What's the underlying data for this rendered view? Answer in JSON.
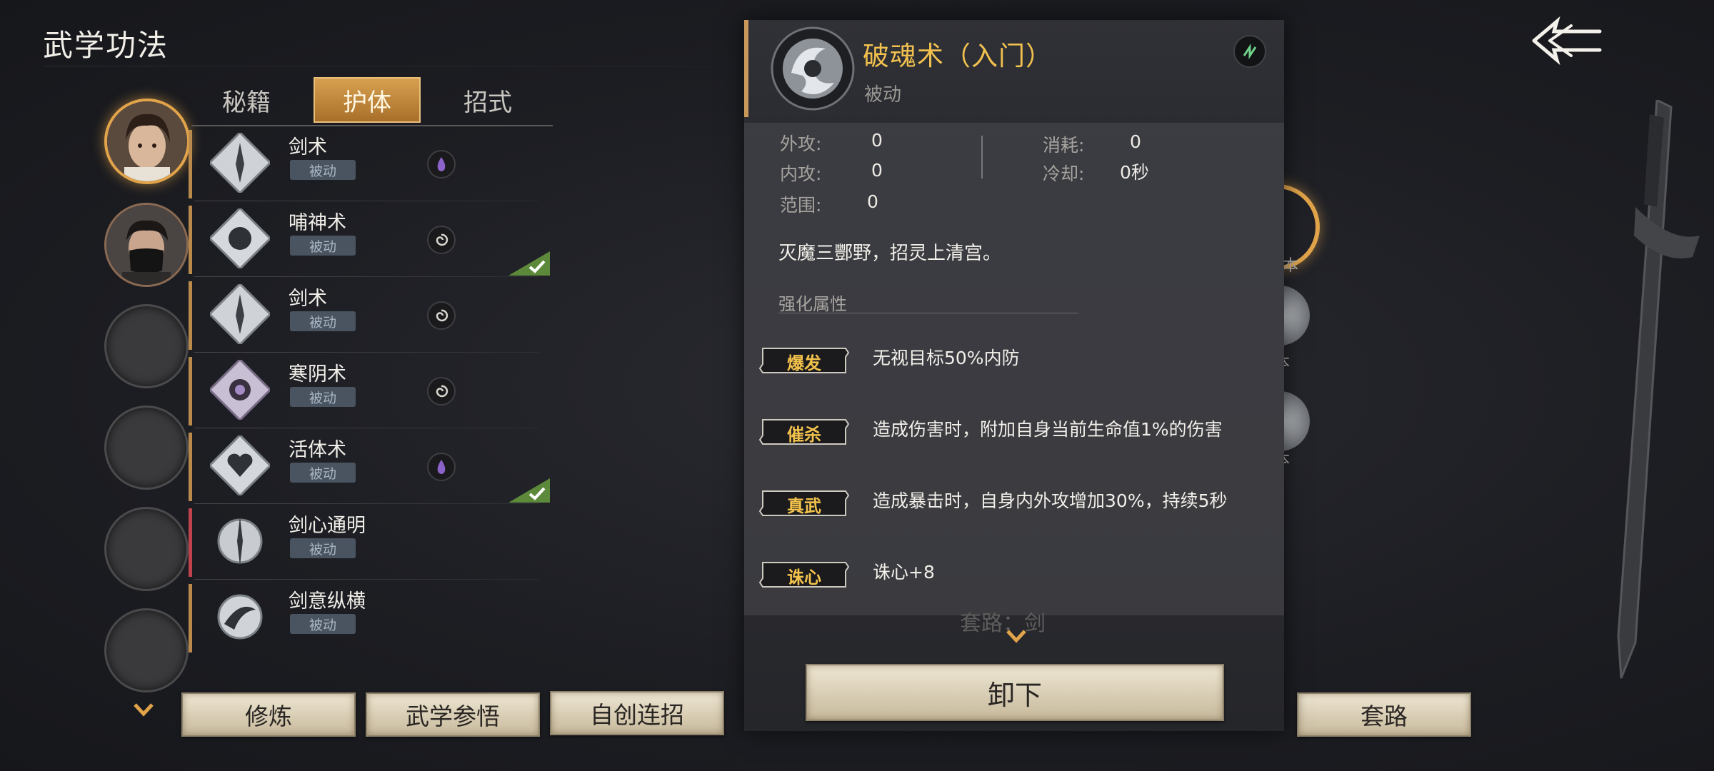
{
  "header": {
    "title": "武学功法"
  },
  "tabs": [
    {
      "label": "秘籍",
      "active": false
    },
    {
      "label": "护体",
      "active": true
    },
    {
      "label": "招式",
      "active": false
    }
  ],
  "skills": [
    {
      "name": "剑术",
      "tag": "被动",
      "slot_icon": "purple-drop-icon",
      "equipped": false,
      "bar": "gold"
    },
    {
      "name": "哺神术",
      "tag": "被动",
      "slot_icon": "swirl-icon",
      "equipped": true,
      "bar": "gold"
    },
    {
      "name": "剑术",
      "tag": "被动",
      "slot_icon": "swirl-icon",
      "equipped": false,
      "bar": "gold"
    },
    {
      "name": "寒阴术",
      "tag": "被动",
      "slot_icon": "swirl-icon",
      "equipped": false,
      "bar": "gold"
    },
    {
      "name": "活体术",
      "tag": "被动",
      "slot_icon": "purple-drop-icon",
      "equipped": true,
      "bar": "gold"
    },
    {
      "name": "剑心通明",
      "tag": "被动",
      "slot_icon": "",
      "equipped": false,
      "bar": "red"
    },
    {
      "name": "剑意纵横",
      "tag": "被动",
      "slot_icon": "",
      "equipped": false,
      "bar": "gold"
    }
  ],
  "bottom_buttons": {
    "cultivate": "修炼",
    "comprehend": "武学参悟",
    "custom_combo": "自创连招",
    "routine": "套路"
  },
  "detail": {
    "title": "破魂术（入门）",
    "type": "被动",
    "stats": {
      "outer_attack_label": "外攻:",
      "outer_attack": "0",
      "inner_attack_label": "内攻:",
      "inner_attack": "0",
      "range_label": "范围:",
      "range": "0",
      "cost_label": "消耗:",
      "cost": "0",
      "cooldown_label": "冷却:",
      "cooldown": "0秒"
    },
    "description": "灭魔三酆野，招灵上清宫。",
    "enhance_title": "强化属性",
    "attributes": [
      {
        "tag": "爆发",
        "text": "无视目标50%内防"
      },
      {
        "tag": "催杀",
        "text": "造成伤害时，附加自身当前生命值1%的伤害"
      },
      {
        "tag": "真武",
        "text": "造成暴击时，自身内外攻增加30%，持续5秒"
      },
      {
        "tag": "诛心",
        "text": "诛心+8"
      }
    ],
    "combo_hint": "套路：剑",
    "unequip_label": "卸下"
  },
  "right_side": {
    "labels": [
      "本",
      "护本",
      "护本"
    ]
  },
  "colors": {
    "accent_gold": "#e2a44a",
    "title_gold": "#f1c04e",
    "tag_bg": "#495460"
  }
}
